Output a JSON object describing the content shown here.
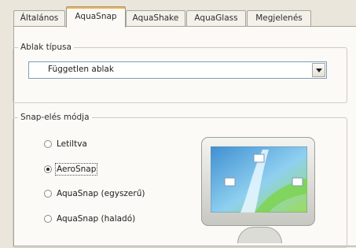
{
  "tabs": [
    "Általános",
    "AquaSnap",
    "AquaShake",
    "AquaGlass",
    "Megjelenés"
  ],
  "active_tab_index": 1,
  "window_type": {
    "legend": "Ablak típusa",
    "selected": "Független ablak"
  },
  "snap_mode": {
    "legend": "Snap-elés módja",
    "options": [
      "Letiltva",
      "AeroSnap",
      "AquaSnap (egyszerű)",
      "AquaSnap (haladó)"
    ],
    "selected_index": 1
  },
  "preview": {
    "icon": "monitor-preview-icon",
    "screen_colors": [
      "#5b9fd6",
      "#e9f7ff",
      "#7cd34a"
    ]
  }
}
